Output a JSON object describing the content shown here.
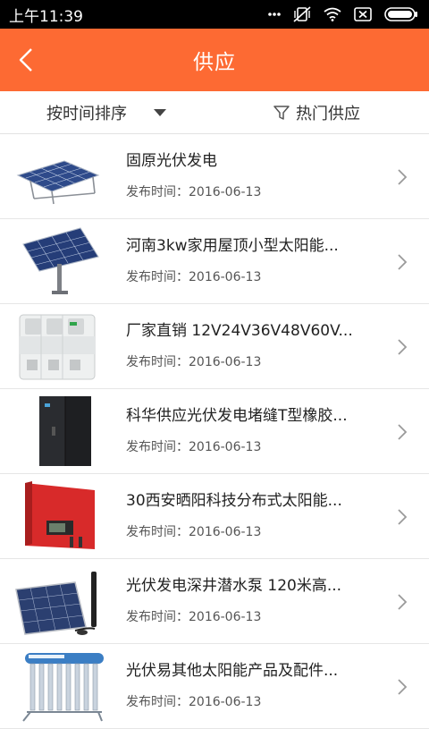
{
  "status_bar": {
    "time": "上午11:39",
    "icons": [
      "more-icon",
      "mute-vibrate-icon",
      "wifi-icon",
      "no-sim-icon",
      "battery-icon"
    ]
  },
  "app_bar": {
    "title": "供应",
    "back_icon": "chevron-left-icon",
    "background": "#fd6a33"
  },
  "filter_bar": {
    "sort_label": "按时间排序",
    "hot_label": "热门供应"
  },
  "items": [
    {
      "title": "固原光伏发电",
      "date": "发布时间：2016-06-13",
      "image": "solar-panel-ground-mount"
    },
    {
      "title": "河南3kw家用屋顶小型太阳能...",
      "date": "发布时间：2016-06-13",
      "image": "solar-panel-tracker"
    },
    {
      "title": "厂家直销 12V24V36V48V60V...",
      "date": "发布时间：2016-06-13",
      "image": "dc-circuit-breaker"
    },
    {
      "title": "科华供应光伏发电堵缝T型橡胶...",
      "date": "发布时间：2016-06-13",
      "image": "inverter-cabinet"
    },
    {
      "title": "30西安晒阳科技分布式太阳能...",
      "date": "发布时间：2016-06-13",
      "image": "red-inverter"
    },
    {
      "title": "光伏发电深井潜水泵 120米高...",
      "date": "发布时间：2016-06-13",
      "image": "solar-pump-panel"
    },
    {
      "title": "光伏易其他太阳能产品及配件...",
      "date": "发布时间：2016-06-13",
      "image": "solar-water-heater"
    }
  ]
}
